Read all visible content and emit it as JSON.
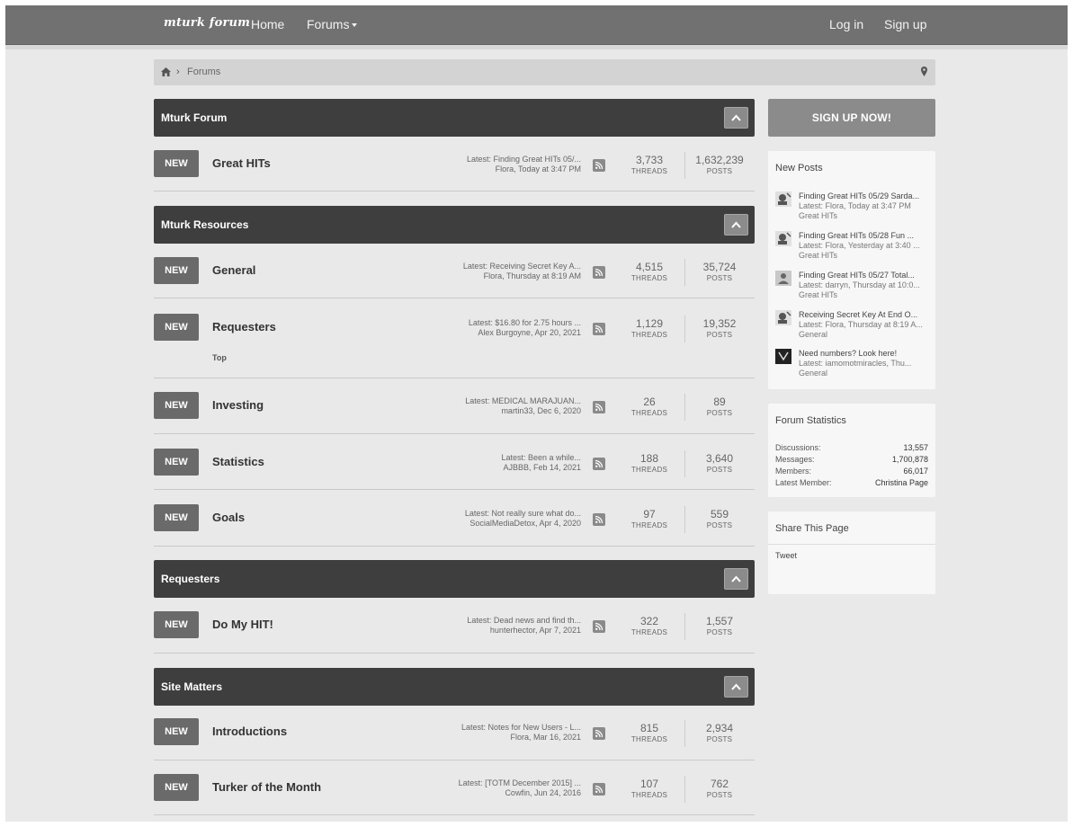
{
  "nav": {
    "logo": "mturk forum",
    "home": "Home",
    "forums": "Forums",
    "login": "Log in",
    "signup": "Sign up"
  },
  "breadcrumb": {
    "current": "Forums"
  },
  "categories": [
    {
      "title": "Mturk Forum"
    },
    {
      "title": "Mturk Resources"
    },
    {
      "title": "Requesters"
    },
    {
      "title": "Site Matters"
    }
  ],
  "badge_label": "NEW",
  "stat_labels": {
    "threads": "THREADS",
    "posts": "POSTS"
  },
  "forums": [
    {
      "name": "Great HITs",
      "latest": "Latest: Finding Great HITs 05/...",
      "by": "Flora, Today at 3:47 PM",
      "threads": "3,733",
      "posts": "1,632,239"
    },
    {
      "name": "General",
      "latest": "Latest: Receiving Secret Key A...",
      "by": "Flora, Thursday at 8:19 AM",
      "threads": "4,515",
      "posts": "35,724"
    },
    {
      "name": "Requesters",
      "latest": "Latest: $16.80 for 2.75 hours ...",
      "by": "Alex Burgoyne, Apr 20, 2021",
      "threads": "1,129",
      "posts": "19,352",
      "subforum": "Top"
    },
    {
      "name": "Investing",
      "latest": "Latest: MEDICAL MARAJUAN...",
      "by": "martin33, Dec 6, 2020",
      "threads": "26",
      "posts": "89"
    },
    {
      "name": "Statistics",
      "latest": "Latest: Been a while...",
      "by": "AJBBB, Feb 14, 2021",
      "threads": "188",
      "posts": "3,640"
    },
    {
      "name": "Goals",
      "latest": "Latest: Not really sure what do...",
      "by": "SocialMediaDetox, Apr 4, 2020",
      "threads": "97",
      "posts": "559"
    },
    {
      "name": "Do My HIT!",
      "latest": "Latest: Dead news and find th...",
      "by": "hunterhector, Apr 7, 2021",
      "threads": "322",
      "posts": "1,557"
    },
    {
      "name": "Introductions",
      "latest": "Latest: Notes for New Users - L...",
      "by": "Flora, Mar 16, 2021",
      "threads": "815",
      "posts": "2,934"
    },
    {
      "name": "Turker of the Month",
      "latest": "Latest: [TOTM December 2015] ...",
      "by": "Cowfin, Jun 24, 2016",
      "threads": "107",
      "posts": "762"
    }
  ],
  "sidebar": {
    "signup_now": "SIGN UP NOW!",
    "new_posts_title": "New Posts",
    "new_posts": [
      {
        "title": "Finding Great HITs 05/29 Sarda...",
        "meta": "Latest: Flora, Today at 3:47 PM",
        "forum": "Great HITs"
      },
      {
        "title": "Finding Great HITs 05/28 Fun ...",
        "meta": "Latest: Flora, Yesterday at 3:40 ...",
        "forum": "Great HITs"
      },
      {
        "title": "Finding Great HITs 05/27 Total...",
        "meta": "Latest: darryn, Thursday at 10:0...",
        "forum": "Great HITs"
      },
      {
        "title": "Receiving Secret Key At End O...",
        "meta": "Latest: Flora, Thursday at 8:19 A...",
        "forum": "General"
      },
      {
        "title": "Need numbers? Look here!",
        "meta": "Latest: iamomotmiracles, Thu...",
        "forum": "General"
      }
    ],
    "stats_title": "Forum Statistics",
    "stats": [
      {
        "label": "Discussions:",
        "value": "13,557"
      },
      {
        "label": "Messages:",
        "value": "1,700,878"
      },
      {
        "label": "Members:",
        "value": "66,017"
      },
      {
        "label": "Latest Member:",
        "value": "Christina Page"
      }
    ],
    "share_title": "Share This Page",
    "tweet": "Tweet"
  }
}
